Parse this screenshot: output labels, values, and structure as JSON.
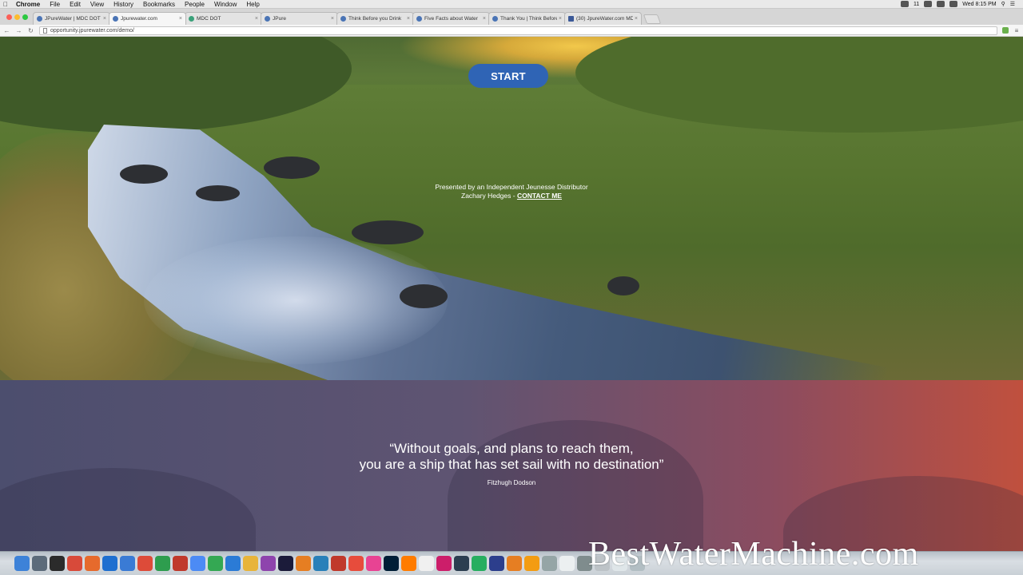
{
  "menubar": {
    "app": "Chrome",
    "items": [
      "File",
      "Edit",
      "View",
      "History",
      "Bookmarks",
      "People",
      "Window",
      "Help"
    ],
    "clock": "Wed 8:15 PM",
    "battery_label": "11"
  },
  "tabs": [
    {
      "title": "JPureWater | MDC DOT | ...",
      "active": false,
      "icon": "page-icon"
    },
    {
      "title": "Jpurewater.com",
      "active": true,
      "icon": "page-icon"
    },
    {
      "title": "MDC DOT",
      "active": false,
      "icon": "mdc-icon"
    },
    {
      "title": "JPure",
      "active": false,
      "icon": "page-icon"
    },
    {
      "title": "Think Before you Drink",
      "active": false,
      "icon": "page-icon"
    },
    {
      "title": "Five Facts about Water",
      "active": false,
      "icon": "page-icon"
    },
    {
      "title": "Thank You | Think Before ...",
      "active": false,
      "icon": "page-icon"
    },
    {
      "title": "(30) JpureWater.com MDC...",
      "active": false,
      "icon": "facebook-icon"
    }
  ],
  "address": {
    "url": "opportunity.jpurewater.com/demo/"
  },
  "hero": {
    "start_label": "START",
    "presented_line": "Presented by an Independent Jeunesse Distributor",
    "distributor_name": "Zachary Hedges - ",
    "contact_label": "CONTACT ME"
  },
  "quote": {
    "line1": "“Without goals, and plans to reach them,",
    "line2": "you are a ship that has set sail with no destination”",
    "author": "Fitzhugh Dodson"
  },
  "dock": {
    "icon_colors": [
      "#3d82d8",
      "#5c6b7a",
      "#2b2b2b",
      "#d84a3a",
      "#e66a2c",
      "#1e6fd0",
      "#3a7bd5",
      "#dd4b39",
      "#2e9d4e",
      "#c0392b",
      "#4c8bf5",
      "#34a853",
      "#2b7bd6",
      "#e8b43a",
      "#8e44ad",
      "#1b1b3a",
      "#e67e22",
      "#2980b9",
      "#c0392b",
      "#e74c3c",
      "#e84393",
      "#001e36",
      "#ff7c00",
      "#f0f0f0",
      "#cc1e6a",
      "#2c3e50",
      "#27ae60",
      "#2c3e8c",
      "#e67e22",
      "#f39c12",
      "#95a5a6",
      "#ecf0f1",
      "#7f8c8d",
      "#bdc3c7",
      "#dfe6e9",
      "#b2bec3"
    ]
  },
  "watermark": "BestWaterMachine.com"
}
